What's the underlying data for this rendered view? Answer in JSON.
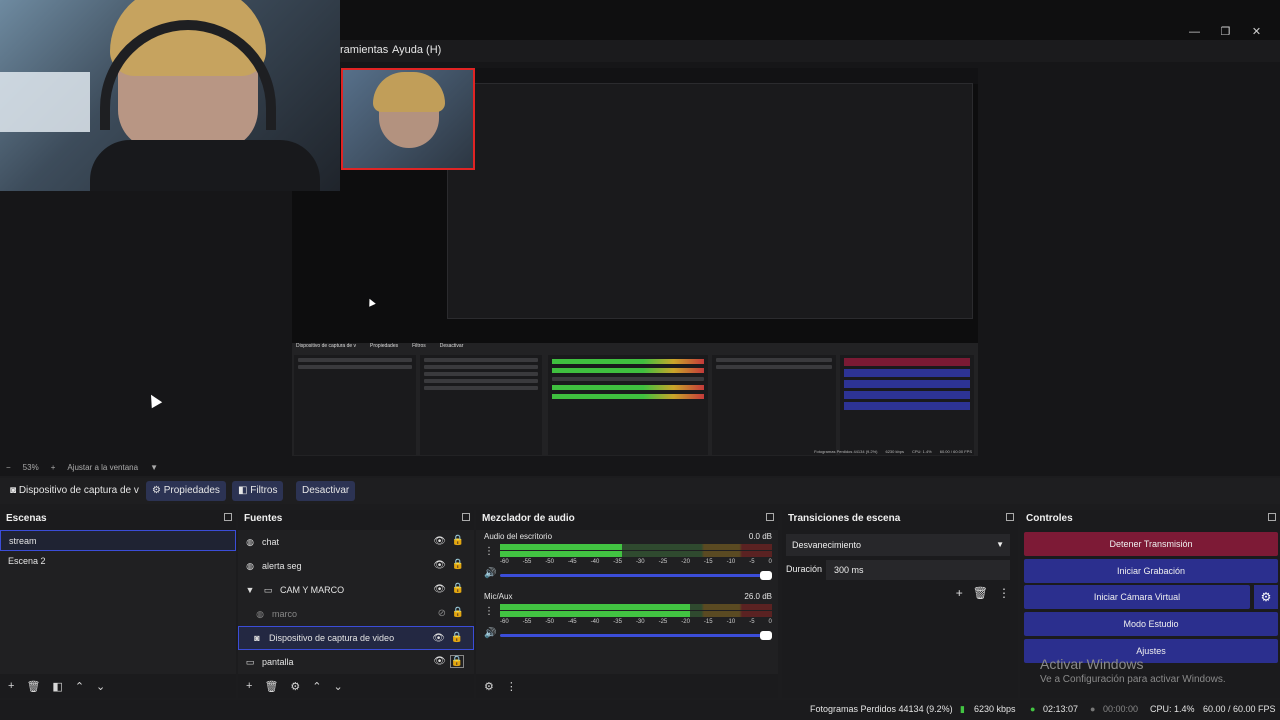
{
  "window": {
    "controls": {
      "minimize": "—",
      "maximize": "❐",
      "close": "✕"
    }
  },
  "menu": {
    "items": [
      "ramientas",
      "Ayuda (H)"
    ]
  },
  "preview": {
    "zoom": "53%",
    "fit_label": "Ajustar a la ventana",
    "nested_context": [
      "Dispositivo de captura de v",
      "Propiedades",
      "Filtros",
      "Desactivar"
    ],
    "nested_status": [
      "Fotogramas Perdidos 44134 (9.2%)",
      "6230 kbps",
      "CPU: 1.4%",
      "60.00 / 60.00 FPS"
    ]
  },
  "context_bar": {
    "source_label": "Dispositivo de captura de v",
    "properties_label": "Propiedades",
    "filters_label": "Filtros",
    "deactivate_label": "Desactivar"
  },
  "scenes": {
    "title": "Escenas",
    "items": [
      {
        "label": "stream",
        "active": true
      },
      {
        "label": "Escena 2",
        "active": false
      }
    ]
  },
  "sources": {
    "title": "Fuentes",
    "items": [
      {
        "label": "chat",
        "icon": "globe-icon"
      },
      {
        "label": "alerta seg",
        "icon": "globe-icon"
      },
      {
        "label": "CAM Y MARCO",
        "icon": "folder-icon"
      },
      {
        "label": "marco",
        "icon": "globe-icon"
      },
      {
        "label": "Dispositivo de captura de video",
        "icon": "camera-icon"
      },
      {
        "label": "pantalla",
        "icon": "monitor-icon"
      }
    ]
  },
  "mixer": {
    "title": "Mezclador de audio",
    "channels": [
      {
        "name": "Audio del escritorio",
        "db": "0.0 dB",
        "level": 0.45
      },
      {
        "name": "Mic/Aux",
        "db": "26.0 dB",
        "level": 0.7
      }
    ],
    "ticks": [
      "-60",
      "-55",
      "-50",
      "-45",
      "-40",
      "-35",
      "-30",
      "-25",
      "-20",
      "-15",
      "-10",
      "-5",
      "0"
    ]
  },
  "transitions": {
    "title": "Transiciones de escena",
    "selected": "Desvanecimiento",
    "duration_label": "Duración",
    "duration_value": "300 ms"
  },
  "controls": {
    "title": "Controles",
    "stop_stream": "Detener Transmisión",
    "start_recording": "Iniciar Grabación",
    "start_virtual_cam": "Iniciar Cámara Virtual",
    "studio_mode": "Modo Estudio",
    "settings": "Ajustes"
  },
  "watermark": {
    "title": "Activar Windows",
    "subtitle": "Ve a Configuración para activar Windows."
  },
  "status": {
    "dropped_frames": "Fotogramas Perdidos 44134 (9.2%)",
    "bitrate": "6230 kbps",
    "stream_time": "02:13:07",
    "record_time": "00:00:00",
    "cpu": "CPU: 1.4%",
    "fps": "60.00 / 60.00 FPS"
  }
}
